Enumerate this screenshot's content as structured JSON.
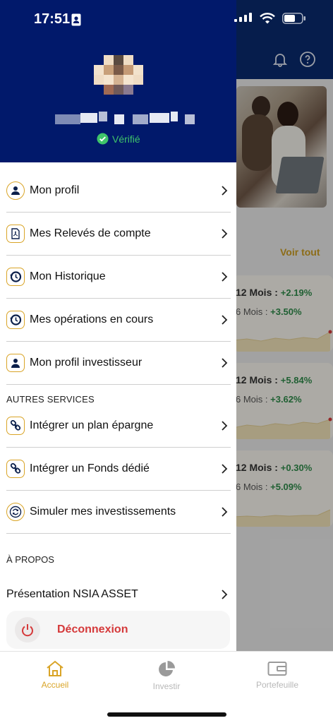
{
  "status_bar": {
    "time": "17:51"
  },
  "drawer": {
    "verified_label": "Vérifié",
    "menu_items": [
      {
        "label": "Mon profil",
        "icon": "user-icon"
      },
      {
        "label": "Mes Relevés de compte",
        "icon": "pdf-icon"
      },
      {
        "label": "Mon Historique",
        "icon": "history-icon"
      },
      {
        "label": "Mes opérations en cours",
        "icon": "history-icon"
      },
      {
        "label": "Mon profil investisseur",
        "icon": "investor-icon"
      }
    ],
    "autres_services_label": "AUTRES SERVICES",
    "services_items": [
      {
        "label": "Intégrer un plan épargne",
        "icon": "link-icon"
      },
      {
        "label": "Intégrer un Fonds dédié",
        "icon": "link-icon"
      },
      {
        "label": "Simuler mes investissements",
        "icon": "simulate-icon"
      }
    ],
    "apropos_label": "À PROPOS",
    "presentation_label": "Présentation NSIA ASSET",
    "logout_label": "Déconnexion"
  },
  "background": {
    "voir_tout": "Voir tout",
    "cards": [
      {
        "line1": "12 Mois : ",
        "value1": "+2.19%",
        "line2": "6 Mois : ",
        "value2": "+3.50%"
      },
      {
        "line1": "12 Mois : ",
        "value1": "+5.84%",
        "line2": "6 Mois : ",
        "value2": "+3.62%"
      },
      {
        "line1": "12 Mois : ",
        "value1": "+0.30%",
        "line2": "6 Mois : ",
        "value2": "+5.09%"
      }
    ]
  },
  "bottom_nav": {
    "items": [
      {
        "label": "Accueil",
        "icon": "home-icon",
        "active": true
      },
      {
        "label": "Investir",
        "icon": "pie-chart-icon",
        "active": false
      },
      {
        "label": "Portefeuille",
        "icon": "wallet-icon",
        "active": false
      }
    ]
  },
  "colors": {
    "drawer_header": "#01196b",
    "accent": "#d9a427",
    "verified": "#3fc46a",
    "logout": "#d5393a",
    "positive": "#2f8a4a"
  }
}
